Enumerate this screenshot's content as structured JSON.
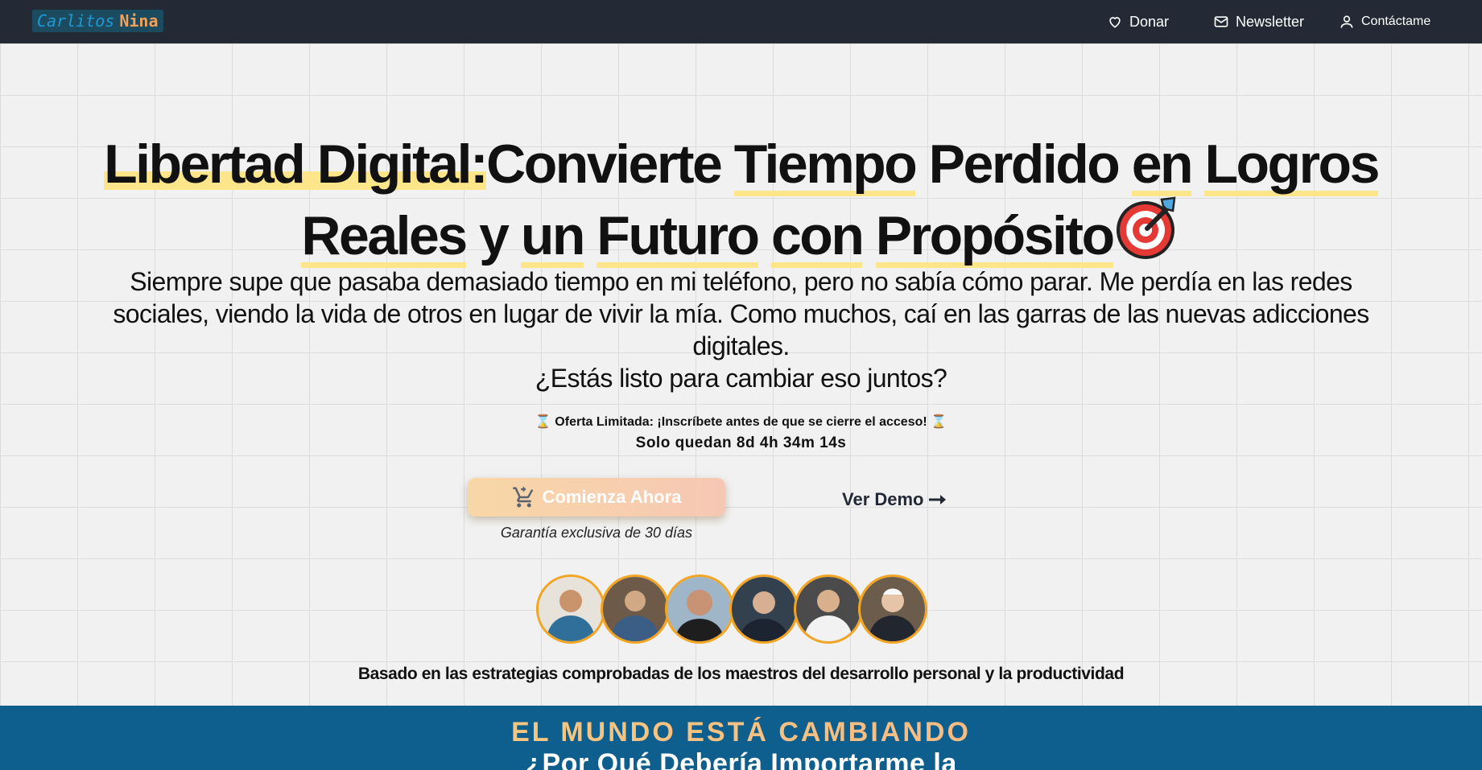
{
  "nav": {
    "logo_part1": "Carlitos",
    "logo_part2": "Nina",
    "donate": "Donar",
    "newsletter": "Newsletter",
    "contact": "Contáctame"
  },
  "hero": {
    "title_highlight": "Libertad Digital:",
    "title_w1": "Convierte",
    "title_w2": "Tiempo",
    "title_w3": "Perdido",
    "title_w4": "en",
    "title_w5": "Logros",
    "title_w6": "Reales",
    "title_w7": "y",
    "title_w8": "un",
    "title_w9": "Futuro",
    "title_w10": "con",
    "title_w11": "Propósito",
    "subtitle": "Siempre supe que pasaba demasiado tiempo en mi teléfono, pero no sabía cómo parar. Me perdía en las redes sociales, viendo la vida de otros en lugar de vivir la mía. Como muchos, caí en las garras de las nuevas adicciones digitales.",
    "question": "¿Estás listo para cambiar eso juntos?",
    "offer": "Oferta Limitada: ¡Inscríbete antes de que se cierre el acceso!",
    "countdown": "Solo quedan 8d 4h 34m 14s",
    "cta": "Comienza Ahora",
    "guarantee": "Garantía exclusiva de 30 días",
    "demo": "Ver Demo",
    "based_on": "Basado en las estrategias comprobadas de los maestros del desarrollo personal y la productividad"
  },
  "band": {
    "kicker": "EL MUNDO ESTÁ CAMBIANDO",
    "title": "¿Por Qué Debería Importarme la"
  },
  "colors": {
    "nav_bg": "#232a35",
    "highlight": "#fde58a",
    "band_bg": "#0e5f8d",
    "avatar_ring": "#f2a423"
  },
  "icons": [
    "heart-icon",
    "mail-icon",
    "user-icon",
    "target-icon",
    "cart-icon",
    "arrow-right-icon",
    "hourglass-icon"
  ]
}
